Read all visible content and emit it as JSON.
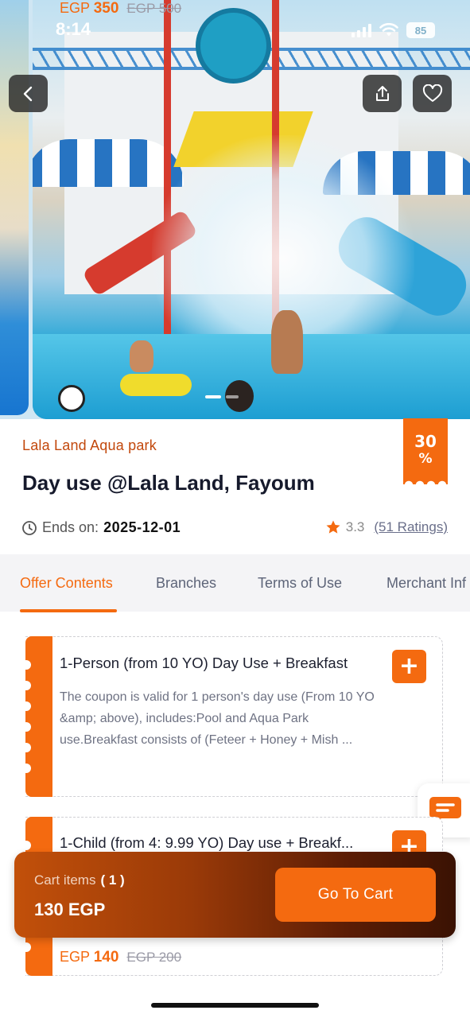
{
  "status_bar": {
    "time": "8:14",
    "battery": "85"
  },
  "hero": {
    "image_alt": "Aqua park water play area",
    "slide_count": 2,
    "active_slide": 0
  },
  "offer": {
    "merchant": "Lala Land Aqua park",
    "title": "Day use @Lala Land, Fayoum",
    "discount_value": "30",
    "discount_unit": "%",
    "ends_label": "Ends on:",
    "ends_date": "2025-12-01",
    "rating": "3.3",
    "rating_count": "(51 Ratings)"
  },
  "tabs": [
    {
      "label": "Offer Contents",
      "active": true
    },
    {
      "label": "Branches",
      "active": false
    },
    {
      "label": "Terms of Use",
      "active": false
    },
    {
      "label": "Merchant Inf",
      "active": false
    }
  ],
  "items": [
    {
      "title": "1-Person (from 10 YO) Day Use + Breakfast",
      "description": "The coupon is valid for 1 person's day use (From 10 YO &amp; above), includes:Pool and Aqua Park use.Breakfast consists of (Feteer + Honey + Mish ...",
      "currency": "EGP",
      "price": "350",
      "old_price": "EGP 500",
      "add_label": "+"
    },
    {
      "title": "1-Child (from 4: 9.99 YO) Day use + Breakf...",
      "currency": "EGP",
      "price": "140",
      "old_price": "EGP 200",
      "add_label": "+"
    }
  ],
  "cart": {
    "label": "Cart items",
    "count": "( 1 )",
    "total": "130 EGP",
    "button": "Go To Cart"
  },
  "colors": {
    "accent": "#f46a10",
    "merchant": "#c2480c",
    "title": "#161a2c"
  },
  "icons": [
    "back-arrow-icon",
    "share-icon",
    "heart-icon",
    "clock-icon",
    "star-icon",
    "plus-icon",
    "chat-icon",
    "signal-icon",
    "wifi-icon",
    "battery-icon"
  ]
}
